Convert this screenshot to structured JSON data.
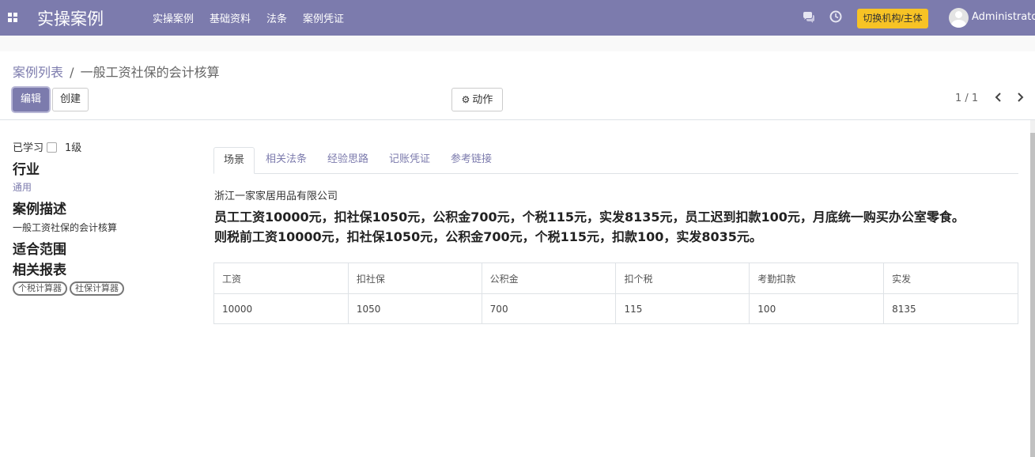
{
  "navbar": {
    "brand": "实操案例",
    "menu": [
      "实操案例",
      "基础资料",
      "法条",
      "案例凭证"
    ],
    "switch_button": "切换机构/主体",
    "user": "Administrator",
    "color": "#7c7bad"
  },
  "breadcrumb": {
    "parent": "案例列表",
    "separator": "/",
    "current": "一般工资社保的会计核算"
  },
  "buttons": {
    "edit": "编辑",
    "create": "创建",
    "action": "动作"
  },
  "pager": {
    "value": "1 / 1"
  },
  "sidebar": {
    "learned_label": "已学习",
    "level": "1级",
    "industry_label": "行业",
    "industry_value": "通用",
    "description_label": "案例描述",
    "description_value": "一般工资社保的会计核算",
    "scope_label": "适合范围",
    "reports_label": "相关报表",
    "tags": [
      "个税计算器",
      "社保计算器"
    ]
  },
  "tabs": [
    "场景",
    "相关法条",
    "经验思路",
    "记账凭证",
    "参考链接"
  ],
  "scene": {
    "company": "浙江一家家居用品有限公司",
    "line1": "员工工资10000元，扣社保1050元，公积金700元，个税115元，实发8135元，员工迟到扣款100元，月底统一购买办公室零食。",
    "line2": "则税前工资10000元，扣社保1050元，公积金700元，个税115元，扣款100，实发8035元。"
  },
  "table": {
    "headers": [
      "工资",
      "扣社保",
      "公积金",
      "扣个税",
      "考勤扣款",
      "实发"
    ],
    "rows": [
      [
        "10000",
        "1050",
        "700",
        "115",
        "100",
        "8135"
      ]
    ]
  }
}
